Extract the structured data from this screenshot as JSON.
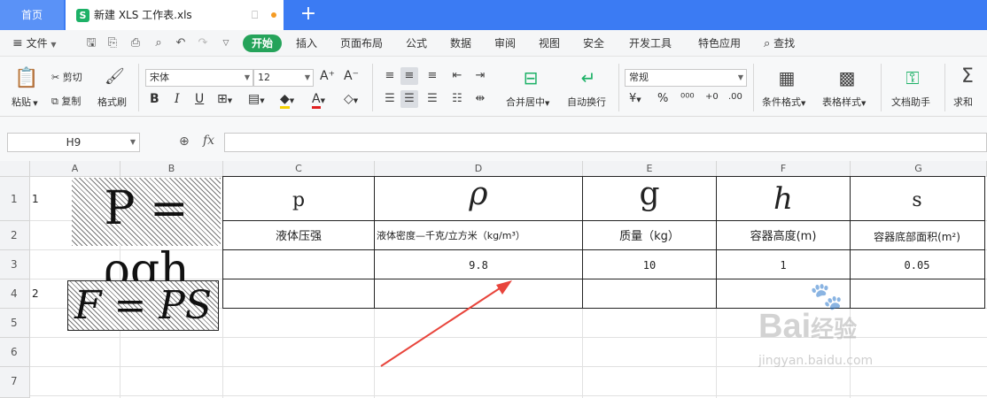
{
  "tabs": {
    "home": "首页",
    "document": "新建 XLS 工作表.xls",
    "add": "+"
  },
  "menu": {
    "file": "文件",
    "start": "开始",
    "items": [
      "插入",
      "页面布局",
      "公式",
      "数据",
      "审阅",
      "视图",
      "安全",
      "开发工具",
      "特色应用"
    ],
    "search": "查找"
  },
  "ribbon": {
    "paste": "粘贴",
    "cut": "剪切",
    "copy": "复制",
    "format_painter": "格式刷",
    "font_name": "宋体",
    "font_size": "12",
    "grow_font": "A⁺",
    "shrink_font": "A⁻",
    "bold": "B",
    "italic": "I",
    "underline": "U",
    "merge_center": "合并居中",
    "wrap_text": "自动换行",
    "number_format": "常规",
    "conditional_format": "条件格式",
    "table_style": "表格样式",
    "doc_assistant": "文档助手",
    "sum": "求和"
  },
  "formula_bar": {
    "name_box": "H9",
    "fx": "fx",
    "content": ""
  },
  "grid": {
    "columns": [
      "A",
      "B",
      "C",
      "D",
      "E",
      "F",
      "G"
    ],
    "rows": [
      "1",
      "2",
      "3",
      "4",
      "5",
      "6",
      "7"
    ],
    "cells": {
      "A1": "1",
      "A4": "2",
      "C1": "p",
      "D1": "ρ",
      "E1": "g",
      "F1": "h",
      "G1": "s",
      "C2": "液体压强",
      "D2": "液体密度—千克/立方米（kg/m³）",
      "E2": "质量（kg）",
      "F2": "容器高度(m)",
      "G2": "容器底部面积(m²)",
      "D3": "9.8",
      "E3": "10",
      "F3": "1",
      "G3": "0.05"
    },
    "formula_images": {
      "pressure": "P = ρgh",
      "force": "F = PS"
    }
  },
  "watermark": {
    "brand": "Bai",
    "brand_cn": "经验",
    "url": "jingyan.baidu.com"
  },
  "colors": {
    "tabbar": "#3b7bf3",
    "start_button": "#25a35a",
    "arrow": "#e8453c"
  }
}
